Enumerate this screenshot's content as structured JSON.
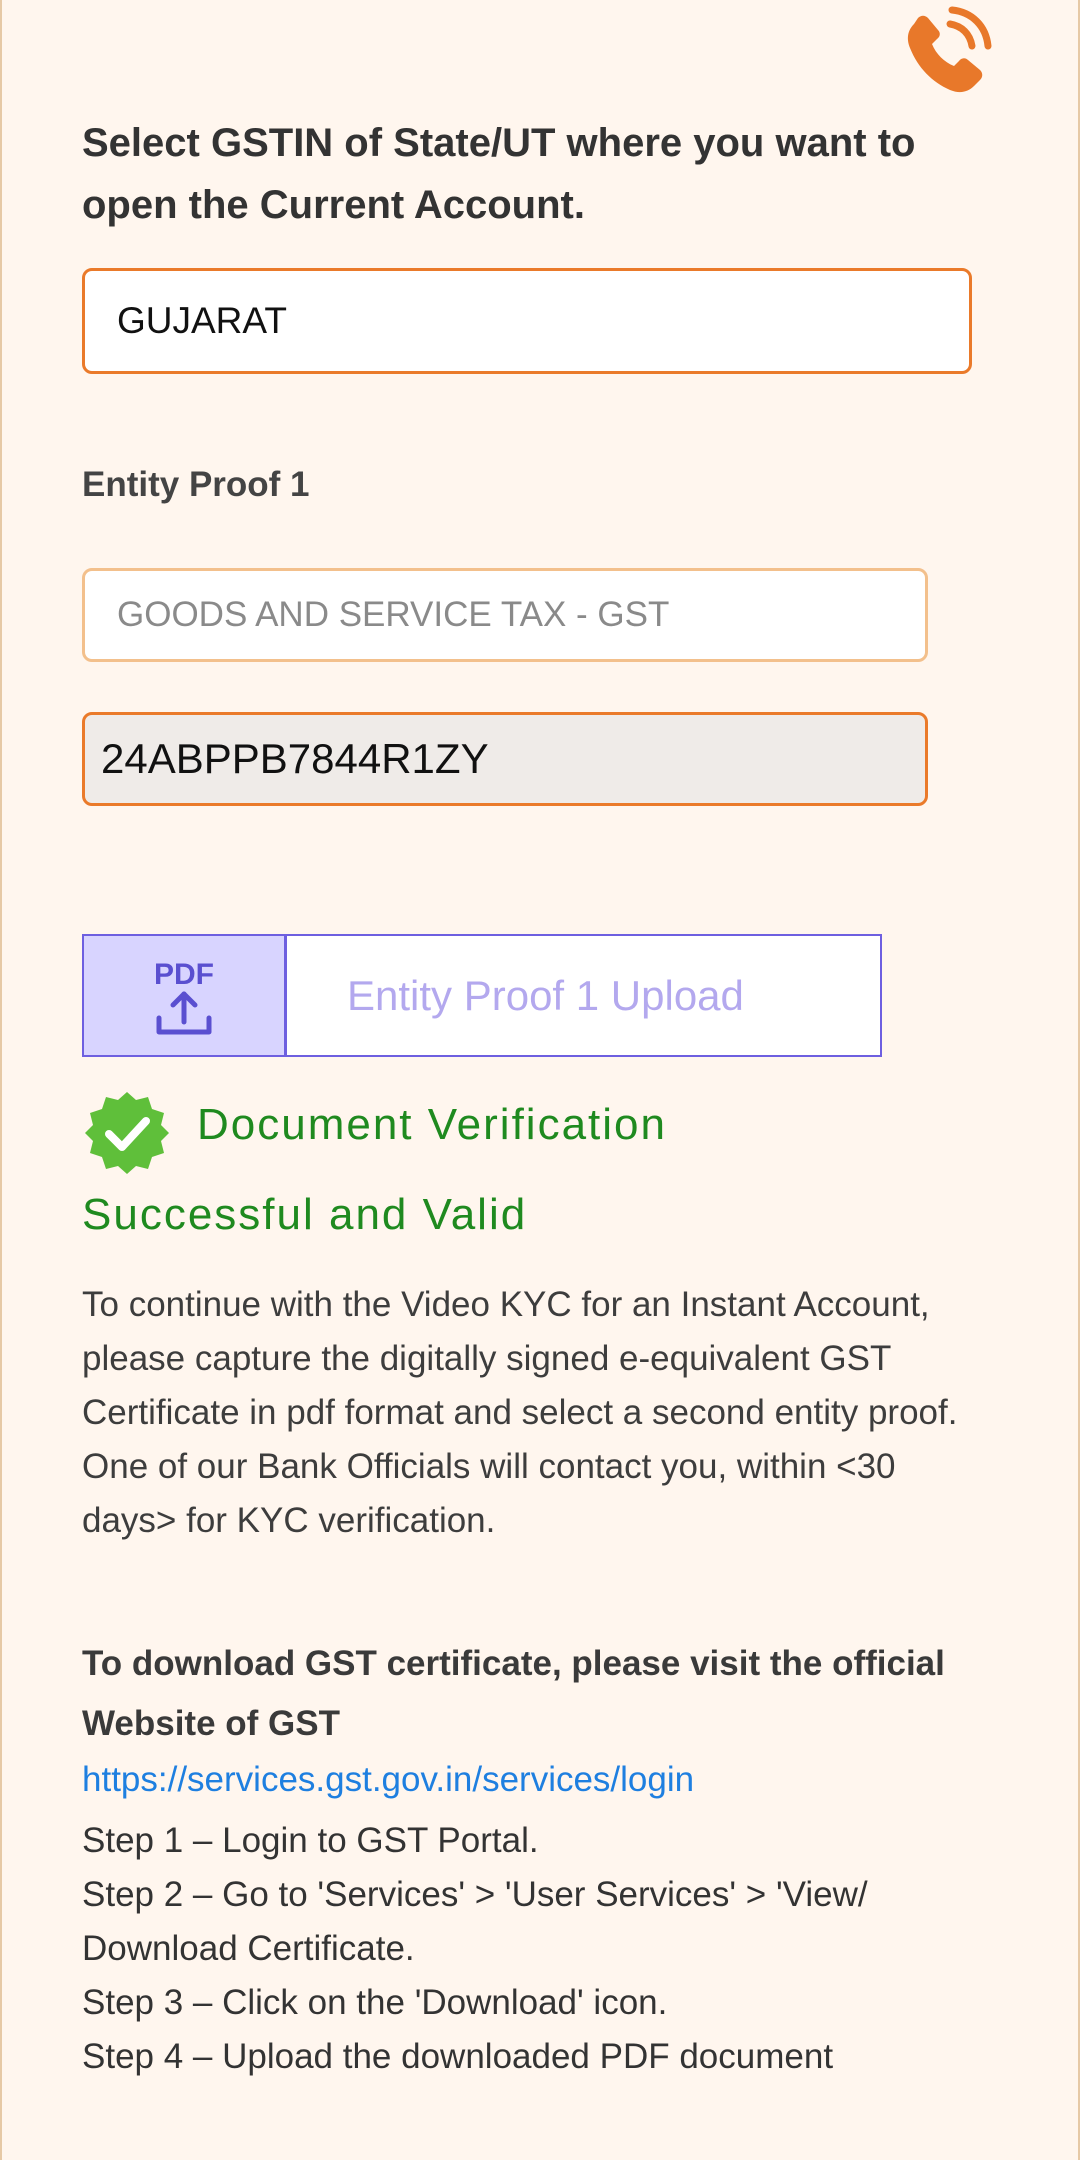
{
  "header": {
    "call_icon": "phone-call-icon",
    "title": "Select GSTIN of State/UT where you want to open the Current Account."
  },
  "state_select": {
    "value": "GUJARAT"
  },
  "entity_proof": {
    "label": "Entity Proof 1",
    "type_placeholder": "GOODS AND SERVICE TAX - GST",
    "gstin_value": "24ABPPB7844R1ZY"
  },
  "upload": {
    "icon": "pdf-upload-icon",
    "icon_text": "PDF",
    "label": "Entity Proof 1 Upload"
  },
  "verification": {
    "icon": "verified-badge-icon",
    "line1": "Document Verification",
    "line2": "Successful and Valid",
    "color": "#1f8a1f"
  },
  "info_text": "To continue with the Video KYC for an Instant Account, please capture the digitally signed e-equivalent GST Certificate in pdf format and select a second entity proof. One of our Bank Officials will contact you, within <30 days> for KYC verification.",
  "download": {
    "heading": "To download GST certificate, please visit the official Website of GST",
    "link": "https://services.gst.gov.in/services/login",
    "steps": [
      "Step 1 – Login to GST Portal.",
      "Step 2 – Go to 'Services' > 'User Services' > 'View/ Download Certificate.",
      "Step 3 – Click on the 'Download' icon.",
      "Step 4 – Upload the downloaded PDF document"
    ]
  },
  "colors": {
    "accent": "#ea7a2a",
    "background": "#fff6ee",
    "upload_border": "#6e5fe0",
    "link": "#1e7fe0"
  }
}
